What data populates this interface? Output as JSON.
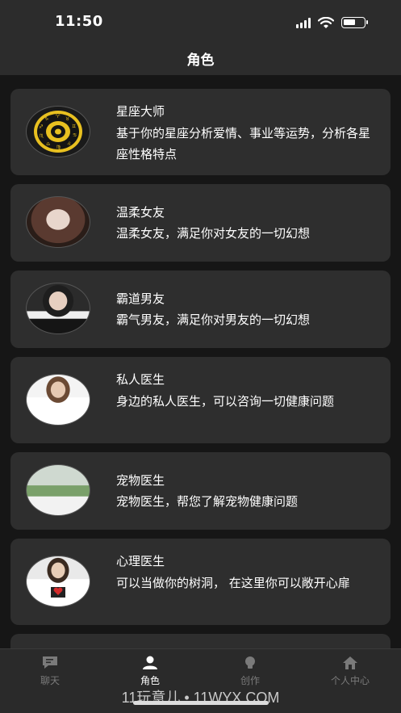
{
  "status": {
    "time": "11:50"
  },
  "header": {
    "title": "角色"
  },
  "roles": [
    {
      "title": "星座大师",
      "desc": "基于你的星座分析爱情、事业等运势，分析各星座性格特点"
    },
    {
      "title": "温柔女友",
      "desc": "温柔女友，满足你对女友的一切幻想"
    },
    {
      "title": "霸道男友",
      "desc": "霸气男友，满足你对男友的一切幻想"
    },
    {
      "title": "私人医生",
      "desc": "身边的私人医生，可以咨询一切健康问题"
    },
    {
      "title": "宠物医生",
      "desc": "宠物医生，帮您了解宠物健康问题"
    },
    {
      "title": "心理医生",
      "desc": "可以当做你的树洞， 在这里你可以敞开心扉"
    }
  ],
  "tabbar": {
    "tabs": [
      {
        "label": "聊天",
        "icon": "chat-icon"
      },
      {
        "label": "角色",
        "icon": "person-icon",
        "active": true
      },
      {
        "label": "创作",
        "icon": "bulb-icon"
      },
      {
        "label": "个人中心",
        "icon": "home-icon"
      }
    ]
  },
  "watermark": "11玩意儿 • 11WYX.COM",
  "colors": {
    "background": "#161616",
    "card": "#2e2e2e",
    "bar": "#2c2c2c",
    "accent_gold": "#e8c020"
  }
}
